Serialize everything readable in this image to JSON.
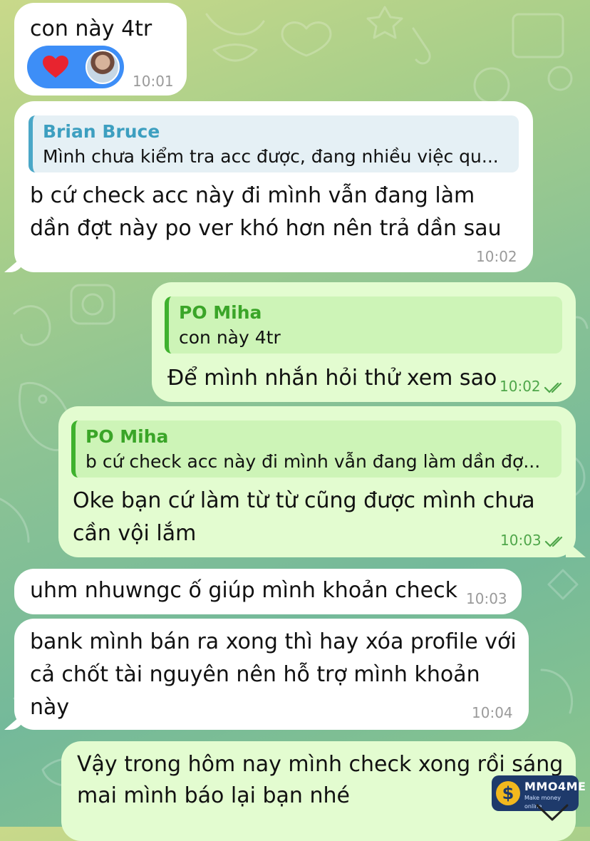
{
  "messages": [
    {
      "text": "con này 4tr",
      "time": "10:01"
    },
    {
      "reply_name": "Brian Bruce",
      "reply_text": "Mình chưa kiểm tra acc được, đang nhiều việc qu...",
      "text_line1": "b cứ check acc này đi mình vẫn đang làm",
      "text_line2": "dần đợt này po ver khó hơn nên trả dần sau",
      "time": "10:02"
    },
    {
      "reply_name": "PO Miha",
      "reply_text": "con này 4tr",
      "text": "Để mình nhắn hỏi thử xem sao",
      "time": "10:02"
    },
    {
      "reply_name": "PO Miha",
      "reply_text": "b cứ check acc này đi mình vẫn đang làm dần đợ...",
      "text_line1": "Oke bạn cứ làm từ từ cũng được mình chưa",
      "text_line2": "cần vội lắm",
      "time": "10:03"
    },
    {
      "text": "uhm nhuwngc ố giúp mình khoản check",
      "time": "10:03"
    },
    {
      "text_line1": "bank mình bán ra xong thì hay xóa profile với",
      "text_line2": "cả chốt tài nguyên nên hỗ trợ mình khoản",
      "text_line3": "này",
      "time": "10:04"
    },
    {
      "text_line1": "Vậy trong hôm nay mình check xong rồi sáng",
      "text_line2": "mai mình báo lại bạn nhé"
    }
  ],
  "watermark": {
    "logo": "$",
    "title": "MMO4ME",
    "subtitle": "Make money online"
  },
  "colors": {
    "incoming": "#ffffff",
    "outgoing": "#e3fcd0",
    "reaction": "#3d8ef7",
    "accent_blue": "#4aa7c7",
    "accent_green": "#3fb22e"
  }
}
